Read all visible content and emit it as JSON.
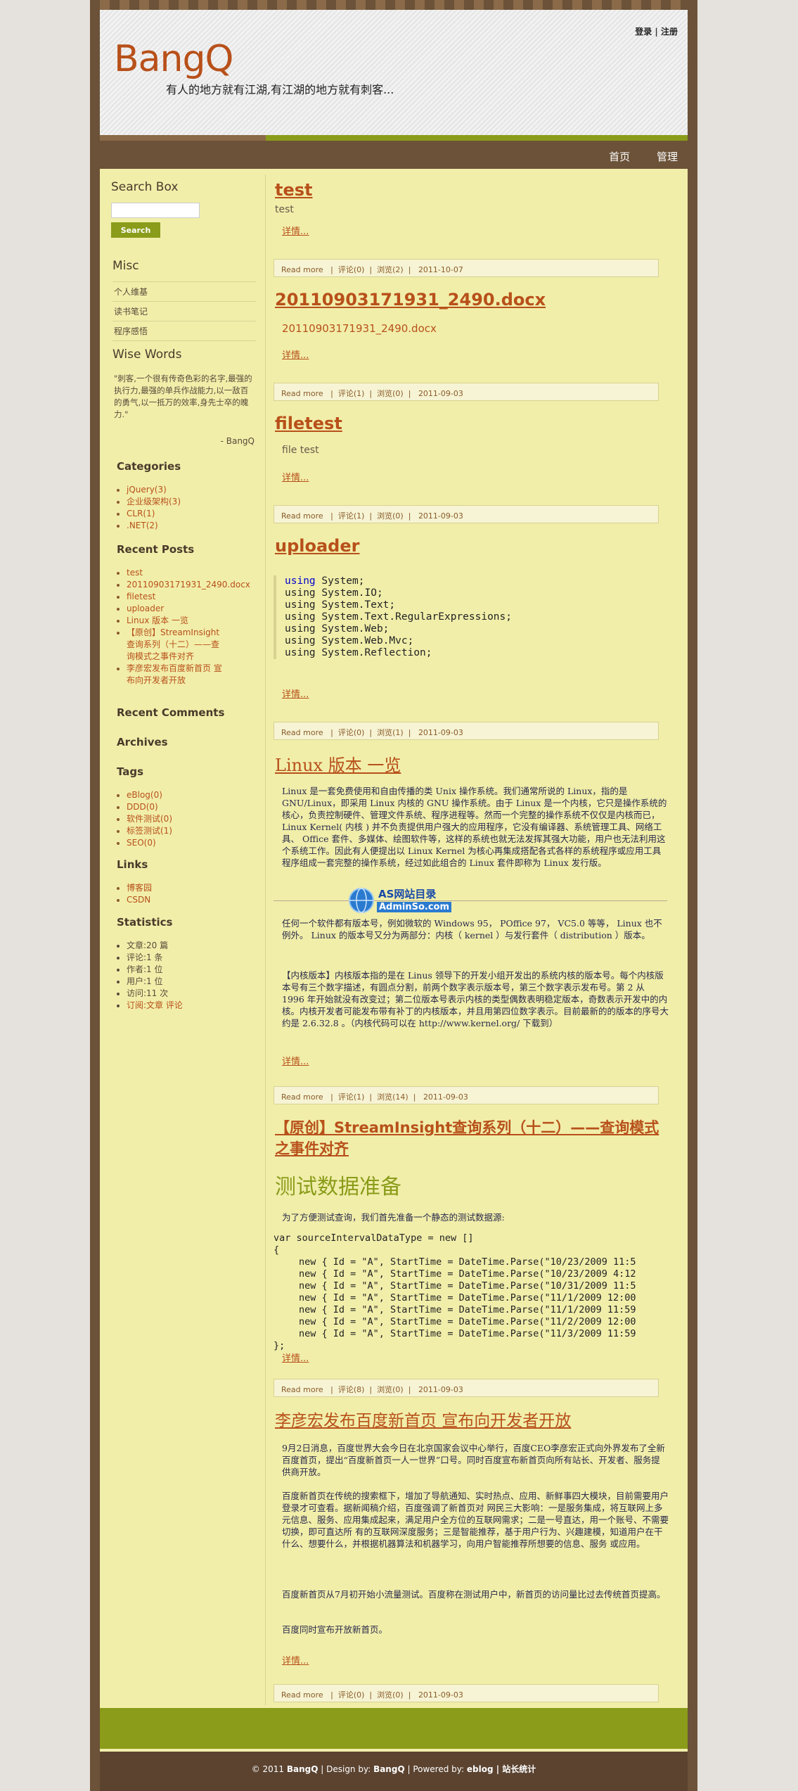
{
  "header": {
    "logo": "BangQ",
    "tagline": "有人的地方就有江湖,有江湖的地方就有刺客...",
    "login": "登录",
    "register": "注册"
  },
  "nav": {
    "home": "首页",
    "manage": "管理"
  },
  "sidebar": {
    "search_title": "Search Box",
    "search_button": "Search",
    "misc_title": "Misc",
    "misc_items": [
      "个人维基",
      "读书笔记",
      "程序感悟"
    ],
    "wise_title": "Wise Words",
    "wise_text": "\"刺客,一个很有传奇色彩的名字,最强的执行力,最强的单兵作战能力,以一敌百的勇气,以一抵万的效率,身先士卒的魄力.\"",
    "wise_author": "- BangQ",
    "categories_title": "Categories",
    "categories": [
      "jQuery(3)",
      "企业级架构(3)",
      "CLR(1)",
      ".NET(2)"
    ],
    "recent_posts_title": "Recent Posts",
    "recent_posts": [
      "test",
      "20110903171931_2490.docx",
      "filetest",
      "uploader",
      "Linux 版本 一览",
      "【原创】StreamInsight查询系列（十二）——查询模式之事件对齐",
      "李彦宏发布百度新首页 宣布向开发者开放"
    ],
    "recent_comments_title": "Recent Comments",
    "archives_title": "Archives",
    "tags_title": "Tags",
    "tags": [
      "eBlog(0)",
      "DDD(0)",
      "软件测试(0)",
      "标签测试(1)",
      "SEO(0)"
    ],
    "links_title": "Links",
    "links": [
      "博客园",
      "CSDN"
    ],
    "stats_title": "Statistics",
    "stats": [
      "文章:20 篇",
      "评论:1 条",
      "作者:1 位",
      "用户:1 位",
      "访问:11 次"
    ],
    "subscribe": "订阅:文章 评论"
  },
  "posts": [
    {
      "title": "test",
      "body": "test",
      "detail": "详情...",
      "read_more": "Read more",
      "comments": "评论(0)",
      "views": "浏览(2)",
      "date": "2011-10-07"
    },
    {
      "title": "20110903171931_2490.docx",
      "body": "20110903171931_2490.docx",
      "detail": "详情...",
      "read_more": "Read more",
      "comments": "评论(1)",
      "views": "浏览(0)",
      "date": "2011-09-03"
    },
    {
      "title": "filetest",
      "body": "file test",
      "detail": "详情...",
      "read_more": "Read more",
      "comments": "评论(1)",
      "views": "浏览(0)",
      "date": "2011-09-03"
    },
    {
      "title": "uploader",
      "code": [
        "using System;",
        "using System.IO;",
        "using System.Text;",
        "using System.Text.RegularExpressions;",
        "using System.Web;",
        "using System.Web.Mvc;",
        "using System.Reflection;"
      ],
      "detail": "详情...",
      "read_more": "Read more",
      "comments": "评论(0)",
      "views": "浏览(1)",
      "date": "2011-09-03"
    },
    {
      "title": "Linux 版本 一览",
      "p1": "Linux 是一套免费使用和自由传播的类 Unix 操作系统。我们通常所说的 Linux，指的是 GNU/Linux，即采用 Linux 内核的 GNU 操作系统。由于 Linux 是一个内核，它只是操作系统的核心，负责控制硬件、管理文件系统、程序进程等。然而一个完整的操作系统不仅仅是内核而已， Linux Kernel( 内核 ) 并不负责提供用户强大的应用程序，它没有编译器、系统管理工具、网络工具、 Office 套件、多媒体、绘图软件等，这样的系统也就无法发挥其强大功能，用户也无法利用这个系统工作。因此有人便提出以 Linux Kernel 为核心再集成搭配各式各样的系统程序或应用工具程序组成一套完整的操作系统，经过如此组合的 Linux 套件即称为 Linux 发行版。",
      "p2": "任何一个软件都有版本号，例如微软的 Windows 95， POffice 97， VC5.0 等等， Linux 也不例外。 Linux 的版本号又分为两部分：内核（ kernel ）与发行套件（ distribution ）版本。",
      "p3": "【内核版本】内核版本指的是在 Linus 领导下的开发小组开发出的系统内核的版本号。每个内核版本号有三个数字描述，有圆点分割，前两个数字表示版本号，第三个数字表示发布号。第 2 从 1996 年开始就没有改变过；第二位版本号表示内核的类型偶数表明稳定版本，奇数表示开发中的内核。内核开发者可能发布带有补丁的内核版本，并且用第四位数字表示。目前最新的的版本的序号大约是 2.6.32.8 。（内核代码可以在 http://www.kernel.org/ 下载到）",
      "detail": "详情...",
      "read_more": "Read more",
      "comments": "评论(1)",
      "views": "浏览(14)",
      "date": "2011-09-03"
    },
    {
      "title": "【原创】StreamInsight查询系列（十二）——查询模式之事件对齐",
      "heading": "测试数据准备",
      "intro": "为了方便测试查询，我们首先准备一个静态的测试数据源:",
      "code_head": "var sourceIntervalDataType = new []",
      "code_rows": [
        "new { Id = \"A\", StartTime = DateTime.Parse(\"10/23/2009 11:5",
        "new { Id = \"A\", StartTime = DateTime.Parse(\"10/23/2009 4:12",
        "new { Id = \"A\", StartTime = DateTime.Parse(\"10/31/2009 11:5",
        "new { Id = \"A\", StartTime = DateTime.Parse(\"11/1/2009 12:00",
        "new { Id = \"A\", StartTime = DateTime.Parse(\"11/1/2009 11:59",
        "new { Id = \"A\", StartTime = DateTime.Parse(\"11/2/2009 12:00",
        "new { Id = \"A\", StartTime = DateTime.Parse(\"11/3/2009 11:59"
      ],
      "detail": "详情...",
      "read_more": "Read more",
      "comments": "评论(8)",
      "views": "浏览(0)",
      "date": "2011-09-03"
    },
    {
      "title": "李彦宏发布百度新首页 宣布向开发者开放",
      "p1": "9月2日消息，百度世界大会今日在北京国家会议中心举行，百度CEO李彦宏正式向外界发布了全新百度首页，提出“百度新首页一人一世界”口号。同时百度宣布新首页向所有站长、开发者、服务提供商开放。",
      "p2": "百度新首页在传统的搜索框下，增加了导航通知、实时热点、应用、新鲜事四大模块，目前需要用户登录才可查看。据新闻稿介绍，百度强调了新首页对 网民三大影响：一是服务集成，将互联网上多元信息、服务、应用集成起来，满足用户全方位的互联网需求；二是一号直达，用一个账号、不需要切换，即可直达所 有的互联网深度服务；三是智能推荐，基于用户行为、兴趣建模，知道用户在干什么、想要什么，并根据机器算法和机器学习，向用户智能推荐所想要的信息、服务 或应用。",
      "p3": "百度新首页从7月初开始小流量测试。百度称在测试用户中，新首页的访问量比过去传统首页提高。",
      "p4": "百度同时宣布开放新首页。",
      "detail": "详情...",
      "read_more": "Read more",
      "comments": "评论(0)",
      "views": "浏览(0)",
      "date": "2011-09-03"
    }
  ],
  "watermark": {
    "line1": "AS网站目录",
    "line2": "AdminSo.com"
  },
  "footer": {
    "copyright": "© 2011 ",
    "site": "BangQ",
    "design_by": " | Design by: ",
    "designer": "BangQ",
    "powered_by": " | Powered by: ",
    "engine": "eblog",
    "stats_link": " | 站长统计"
  }
}
